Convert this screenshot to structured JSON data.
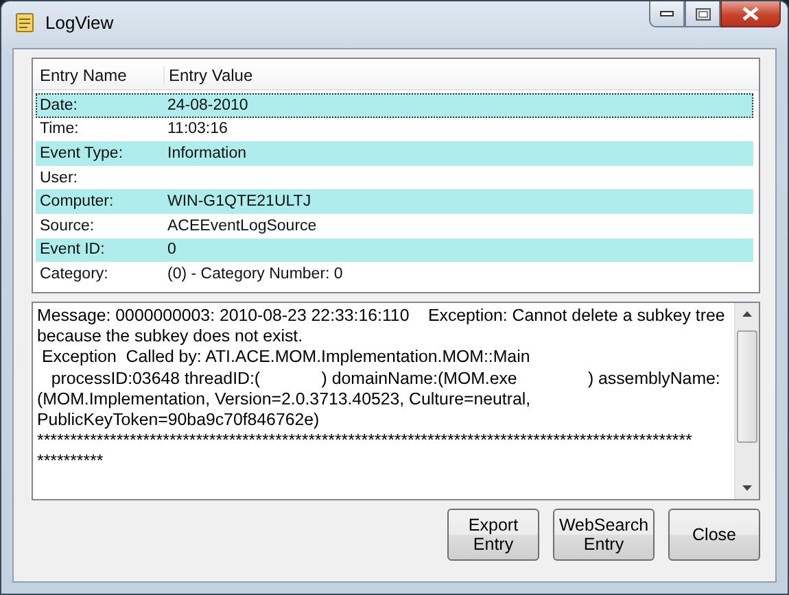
{
  "window": {
    "title": "LogView"
  },
  "list": {
    "columns": [
      "Entry Name",
      "Entry Value"
    ],
    "rows": [
      {
        "name": "Date:",
        "value": "24-08-2010",
        "selected": true
      },
      {
        "name": "Time:",
        "value": "11:03:16",
        "selected": false
      },
      {
        "name": "Event Type:",
        "value": "Information",
        "selected": false
      },
      {
        "name": "User:",
        "value": "",
        "selected": false
      },
      {
        "name": "Computer:",
        "value": "WIN-G1QTE21ULTJ",
        "selected": false
      },
      {
        "name": "Source:",
        "value": "ACEEventLogSource",
        "selected": false
      },
      {
        "name": "Event ID:",
        "value": "0",
        "selected": false
      },
      {
        "name": "Category:",
        "value": "(0) - Category Number: 0",
        "selected": false
      }
    ]
  },
  "message": {
    "lines": [
      "Message: 0000000003: 2010-08-23 22:33:16:110    Exception: Cannot delete a subkey tree",
      "because the subkey does not exist.",
      " Exception  Called by: ATI.ACE.MOM.Implementation.MOM::Main",
      "   processID:03648 threadID:(             ) domainName:(MOM.exe               ) assemblyName:",
      "(MOM.Implementation, Version=2.0.3713.40523, Culture=neutral,",
      "PublicKeyToken=90ba9c70f846762e)",
      "***************************************************************************************************",
      "**********"
    ]
  },
  "buttons": [
    "Export\nEntry",
    "WebSearch\nEntry",
    "Close"
  ]
}
